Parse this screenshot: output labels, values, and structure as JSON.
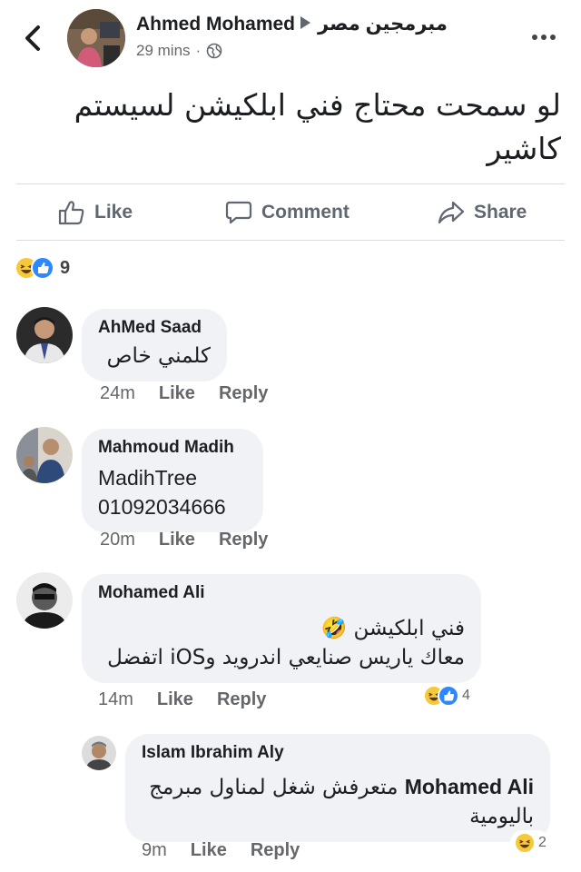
{
  "post": {
    "author": "Ahmed Mohamed",
    "group": "مبرمجين مصر",
    "time": "29 mins",
    "privacy_icon": "globe-icon",
    "text_line1": "لو سمحت محتاج فني ابلكيشن لسيستم",
    "text_line2": "كاشير",
    "actions": {
      "like": "Like",
      "comment": "Comment",
      "share": "Share"
    },
    "reactions": {
      "types": [
        "haha",
        "like"
      ],
      "count": "9"
    }
  },
  "comments": [
    {
      "name": "AhMed Saad",
      "lines": [
        "كلمني خاص"
      ],
      "time": "24m",
      "like": "Like",
      "reply": "Reply"
    },
    {
      "name": "Mahmoud Madih",
      "lines": [
        "MadihTree",
        "01092034666"
      ],
      "time": "20m",
      "like": "Like",
      "reply": "Reply"
    },
    {
      "name": "Mohamed Ali",
      "lines": [
        "فني ابلكيشن 🤣",
        "معاك ياريس صنايعي اندرويد وiOS اتفضل"
      ],
      "time": "14m",
      "like": "Like",
      "reply": "Reply",
      "reactions": {
        "types": [
          "haha",
          "like"
        ],
        "count": "4"
      }
    },
    {
      "name": "Islam Ibrahim Aly",
      "mention": "Mohamed Ali",
      "lines": [
        "متعرفش شغل لمناول مبرمج",
        "باليومية"
      ],
      "time": "9m",
      "like": "Like",
      "reply": "Reply",
      "reactions": {
        "types": [
          "haha"
        ],
        "count": "2"
      }
    }
  ],
  "colors": {
    "accent": "#2d88ff",
    "haha": "#f7c83a",
    "bubble": "#f0f2f5",
    "muted": "#65676b"
  }
}
